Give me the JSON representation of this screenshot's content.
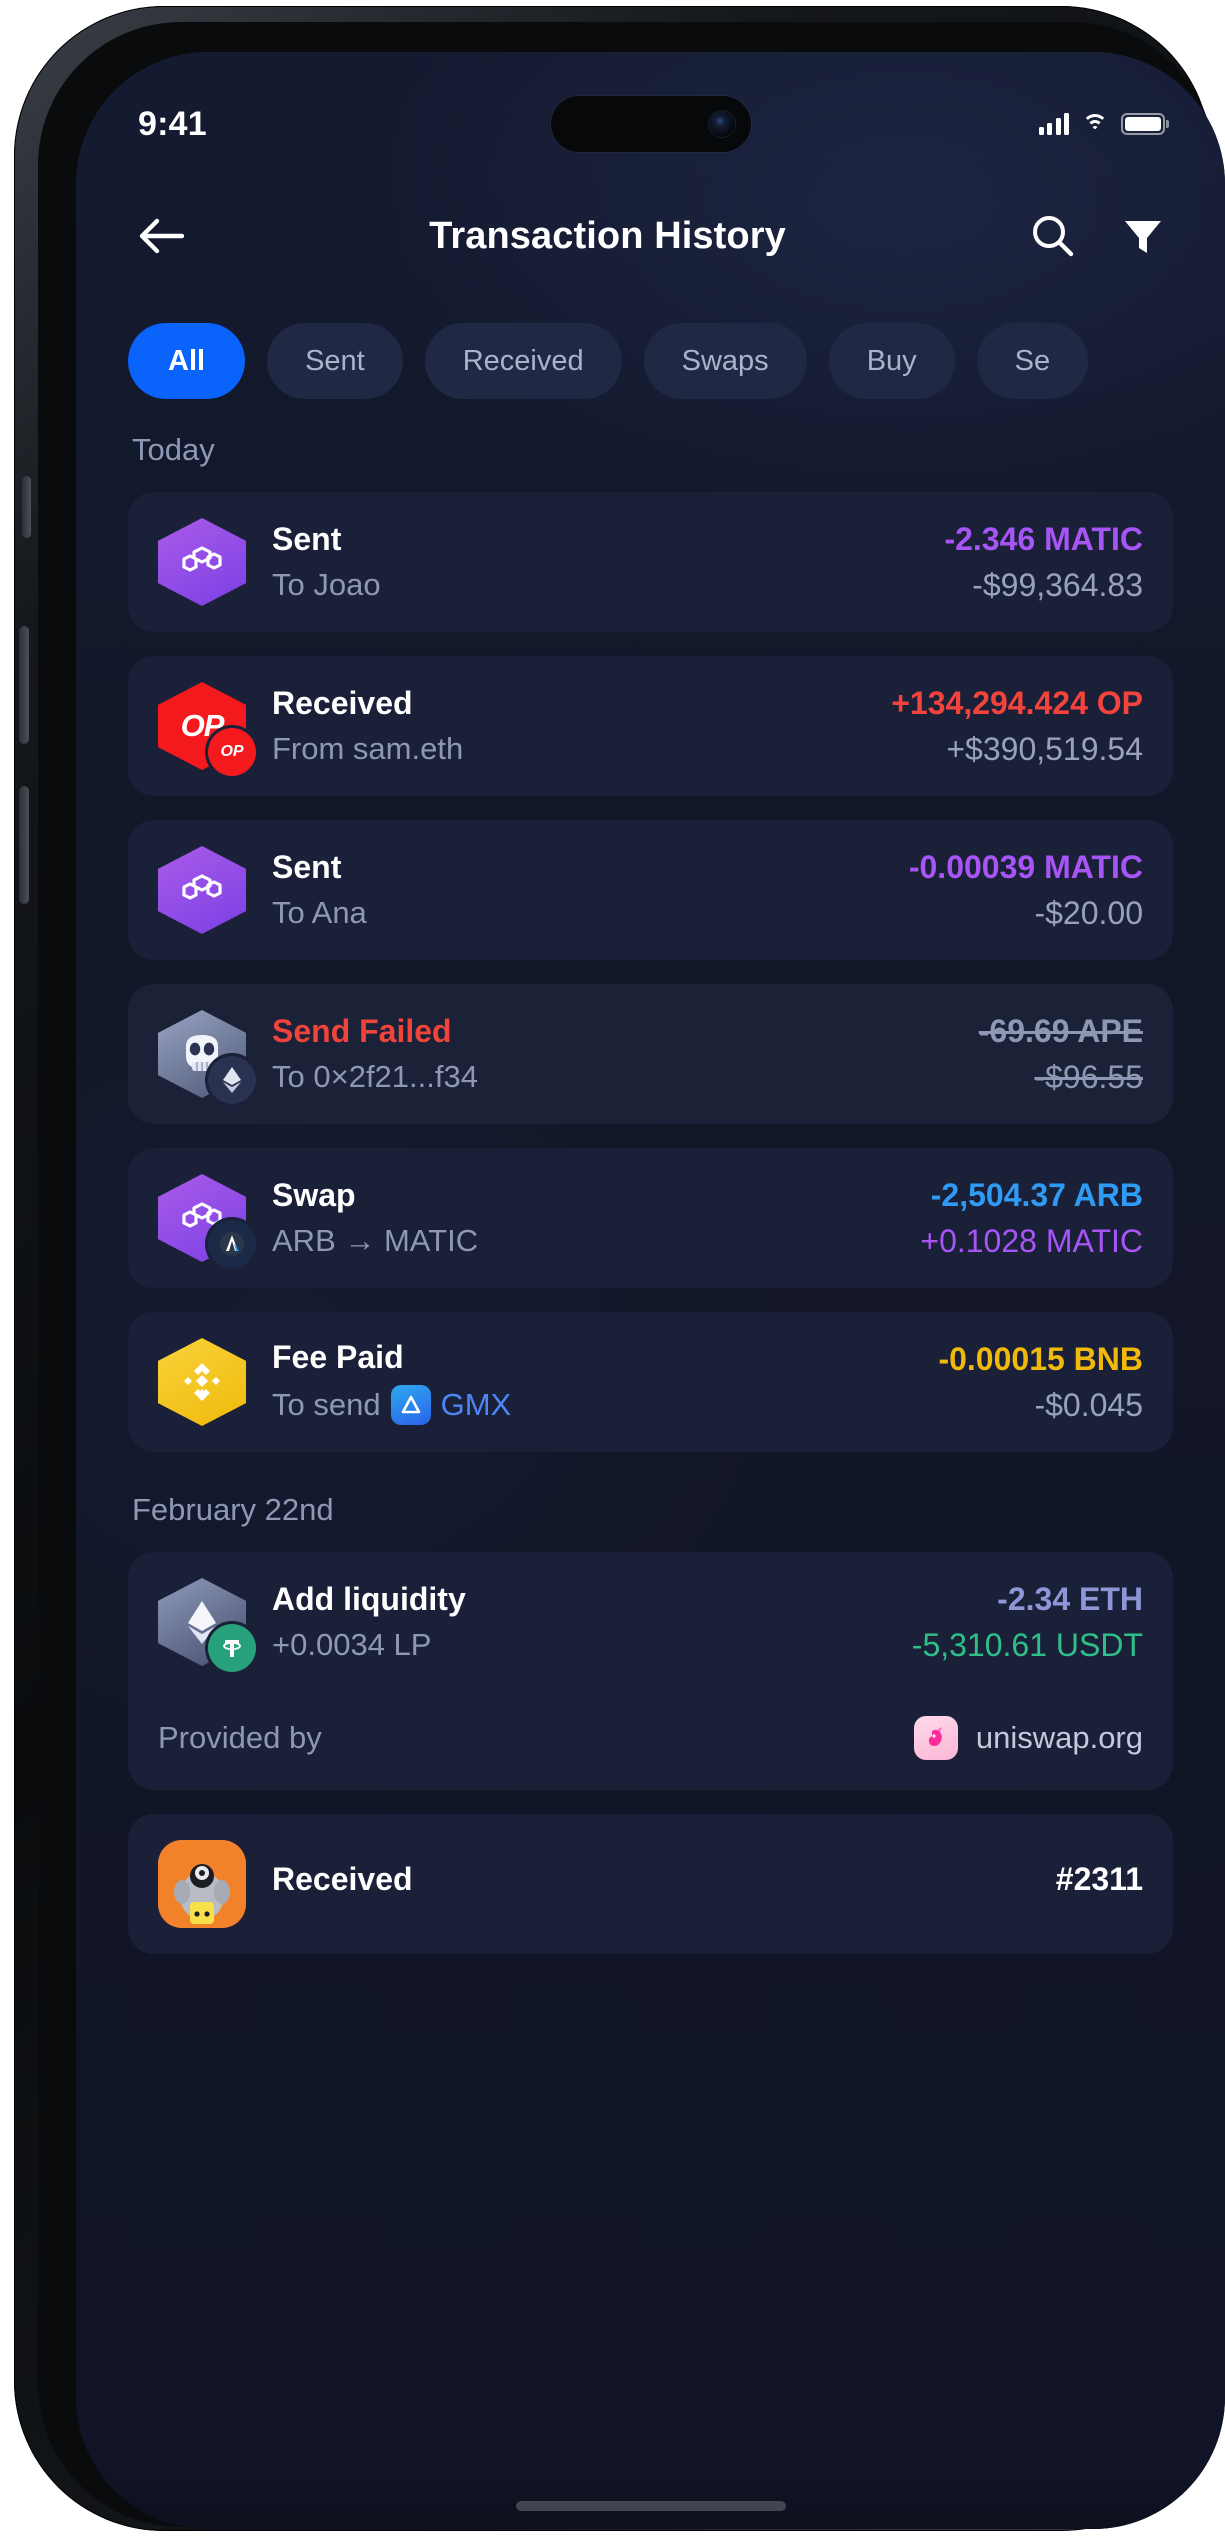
{
  "status_bar": {
    "time": "9:41",
    "signal_icon": "cellular-bars-icon",
    "wifi_icon": "wifi-icon",
    "battery_icon": "battery-full-icon"
  },
  "header": {
    "back_icon": "back-arrow-icon",
    "title": "Transaction History",
    "search_icon": "search-icon",
    "filter_icon": "filter-funnel-icon"
  },
  "filters": {
    "chips": [
      {
        "label": "All",
        "active": true
      },
      {
        "label": "Sent",
        "active": false
      },
      {
        "label": "Received",
        "active": false
      },
      {
        "label": "Swaps",
        "active": false
      },
      {
        "label": "Buy",
        "active": false
      },
      {
        "label": "Se",
        "active": false
      }
    ]
  },
  "sections": [
    {
      "label": "Today"
    },
    {
      "label": "February 22nd"
    }
  ],
  "transactions": {
    "sent_joao": {
      "title": "Sent",
      "subtitle": "To Joao",
      "amount": "-2.346 MATIC",
      "fiat": "-$99,364.83",
      "token_symbol": "MATIC",
      "amount_color": "#a855f7",
      "icon": "polygon-matic-token-icon"
    },
    "received_sam": {
      "title": "Received",
      "subtitle": "From sam.eth",
      "amount": "+134,294.424 OP",
      "fiat": "+$390,519.54",
      "token_symbol": "OP",
      "amount_color": "#f4433c",
      "icon": "optimism-op-token-icon",
      "badge_label": "OP"
    },
    "sent_ana": {
      "title": "Sent",
      "subtitle": "To Ana",
      "amount": "-0.00039 MATIC",
      "fiat": "-$20.00",
      "token_symbol": "MATIC",
      "amount_color": "#a855f7",
      "icon": "polygon-matic-token-icon"
    },
    "send_failed": {
      "title": "Send Failed",
      "subtitle": "To 0×2f21...f34",
      "amount": "-69.69 APE",
      "fiat": "-$96.55",
      "token_symbol": "APE",
      "title_color": "#f0433a",
      "icon": "apecoin-ape-token-icon",
      "badge_icon": "ethereum-badge-icon"
    },
    "swap": {
      "title": "Swap",
      "subtitle": "ARB → MATIC",
      "amount": "-2,504.37 ARB",
      "fiat": "+0.1028 MATIC",
      "amount_color": "#2f9bf5",
      "fiat_color": "#a855f7",
      "icon": "polygon-matic-token-icon",
      "badge_icon": "arbitrum-badge-icon"
    },
    "fee_paid": {
      "title": "Fee Paid",
      "subtitle_prefix": "To send",
      "subtitle_app": "GMX",
      "amount": "-0.00015 BNB",
      "fiat": "-$0.045",
      "amount_color": "#f0b90b",
      "icon": "binance-bnb-token-icon",
      "app_icon": "gmx-app-icon"
    },
    "add_liquidity": {
      "title": "Add liquidity",
      "subtitle": "+0.0034 LP",
      "amount": "-2.34 ETH",
      "fiat": "-5,310.61 USDT",
      "amount_color": "#8f96d8",
      "fiat_color": "#2fc08a",
      "icon": "ethereum-eth-token-icon",
      "badge_icon": "tether-usdt-badge-icon",
      "provided_by_label": "Provided by",
      "provider_name": "uniswap.org",
      "provider_icon": "uniswap-unicorn-icon"
    },
    "received_nft": {
      "title": "Received",
      "amount": "#2311",
      "icon": "nft-avatar-icon"
    }
  },
  "theme": {
    "accent": "#0a63fb",
    "card_bg": "#1a2038",
    "screen_bg": "#121628",
    "muted_text": "#8e98b5"
  }
}
